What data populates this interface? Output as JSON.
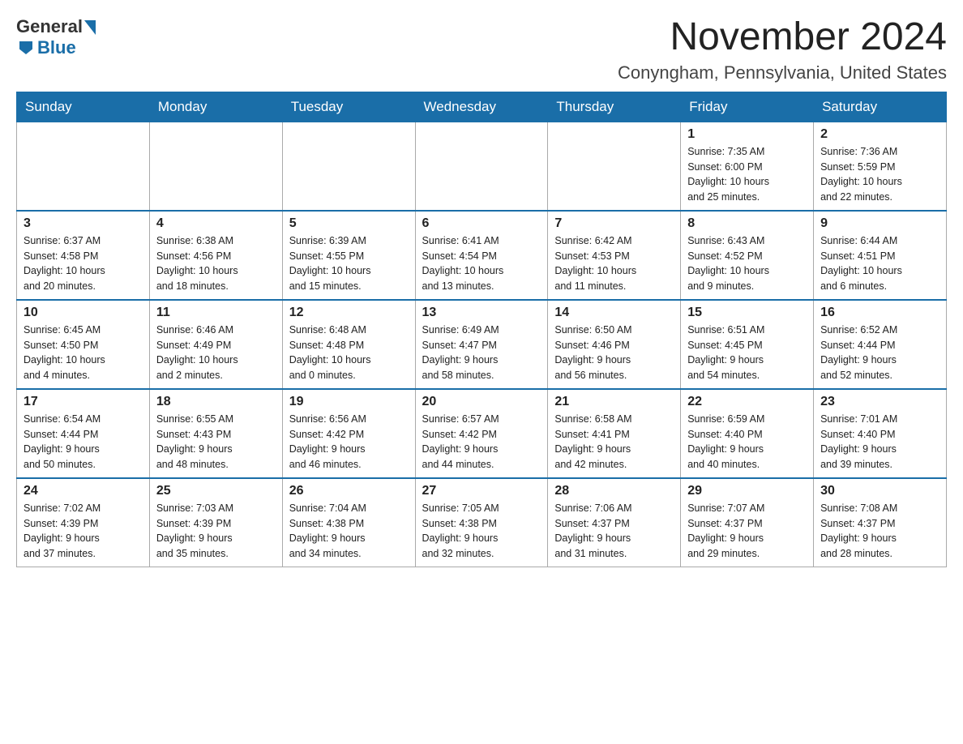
{
  "logo": {
    "general": "General",
    "blue": "Blue"
  },
  "title": "November 2024",
  "location": "Conyngham, Pennsylvania, United States",
  "weekdays": [
    "Sunday",
    "Monday",
    "Tuesday",
    "Wednesday",
    "Thursday",
    "Friday",
    "Saturday"
  ],
  "weeks": [
    [
      {
        "day": "",
        "info": ""
      },
      {
        "day": "",
        "info": ""
      },
      {
        "day": "",
        "info": ""
      },
      {
        "day": "",
        "info": ""
      },
      {
        "day": "",
        "info": ""
      },
      {
        "day": "1",
        "info": "Sunrise: 7:35 AM\nSunset: 6:00 PM\nDaylight: 10 hours\nand 25 minutes."
      },
      {
        "day": "2",
        "info": "Sunrise: 7:36 AM\nSunset: 5:59 PM\nDaylight: 10 hours\nand 22 minutes."
      }
    ],
    [
      {
        "day": "3",
        "info": "Sunrise: 6:37 AM\nSunset: 4:58 PM\nDaylight: 10 hours\nand 20 minutes."
      },
      {
        "day": "4",
        "info": "Sunrise: 6:38 AM\nSunset: 4:56 PM\nDaylight: 10 hours\nand 18 minutes."
      },
      {
        "day": "5",
        "info": "Sunrise: 6:39 AM\nSunset: 4:55 PM\nDaylight: 10 hours\nand 15 minutes."
      },
      {
        "day": "6",
        "info": "Sunrise: 6:41 AM\nSunset: 4:54 PM\nDaylight: 10 hours\nand 13 minutes."
      },
      {
        "day": "7",
        "info": "Sunrise: 6:42 AM\nSunset: 4:53 PM\nDaylight: 10 hours\nand 11 minutes."
      },
      {
        "day": "8",
        "info": "Sunrise: 6:43 AM\nSunset: 4:52 PM\nDaylight: 10 hours\nand 9 minutes."
      },
      {
        "day": "9",
        "info": "Sunrise: 6:44 AM\nSunset: 4:51 PM\nDaylight: 10 hours\nand 6 minutes."
      }
    ],
    [
      {
        "day": "10",
        "info": "Sunrise: 6:45 AM\nSunset: 4:50 PM\nDaylight: 10 hours\nand 4 minutes."
      },
      {
        "day": "11",
        "info": "Sunrise: 6:46 AM\nSunset: 4:49 PM\nDaylight: 10 hours\nand 2 minutes."
      },
      {
        "day": "12",
        "info": "Sunrise: 6:48 AM\nSunset: 4:48 PM\nDaylight: 10 hours\nand 0 minutes."
      },
      {
        "day": "13",
        "info": "Sunrise: 6:49 AM\nSunset: 4:47 PM\nDaylight: 9 hours\nand 58 minutes."
      },
      {
        "day": "14",
        "info": "Sunrise: 6:50 AM\nSunset: 4:46 PM\nDaylight: 9 hours\nand 56 minutes."
      },
      {
        "day": "15",
        "info": "Sunrise: 6:51 AM\nSunset: 4:45 PM\nDaylight: 9 hours\nand 54 minutes."
      },
      {
        "day": "16",
        "info": "Sunrise: 6:52 AM\nSunset: 4:44 PM\nDaylight: 9 hours\nand 52 minutes."
      }
    ],
    [
      {
        "day": "17",
        "info": "Sunrise: 6:54 AM\nSunset: 4:44 PM\nDaylight: 9 hours\nand 50 minutes."
      },
      {
        "day": "18",
        "info": "Sunrise: 6:55 AM\nSunset: 4:43 PM\nDaylight: 9 hours\nand 48 minutes."
      },
      {
        "day": "19",
        "info": "Sunrise: 6:56 AM\nSunset: 4:42 PM\nDaylight: 9 hours\nand 46 minutes."
      },
      {
        "day": "20",
        "info": "Sunrise: 6:57 AM\nSunset: 4:42 PM\nDaylight: 9 hours\nand 44 minutes."
      },
      {
        "day": "21",
        "info": "Sunrise: 6:58 AM\nSunset: 4:41 PM\nDaylight: 9 hours\nand 42 minutes."
      },
      {
        "day": "22",
        "info": "Sunrise: 6:59 AM\nSunset: 4:40 PM\nDaylight: 9 hours\nand 40 minutes."
      },
      {
        "day": "23",
        "info": "Sunrise: 7:01 AM\nSunset: 4:40 PM\nDaylight: 9 hours\nand 39 minutes."
      }
    ],
    [
      {
        "day": "24",
        "info": "Sunrise: 7:02 AM\nSunset: 4:39 PM\nDaylight: 9 hours\nand 37 minutes."
      },
      {
        "day": "25",
        "info": "Sunrise: 7:03 AM\nSunset: 4:39 PM\nDaylight: 9 hours\nand 35 minutes."
      },
      {
        "day": "26",
        "info": "Sunrise: 7:04 AM\nSunset: 4:38 PM\nDaylight: 9 hours\nand 34 minutes."
      },
      {
        "day": "27",
        "info": "Sunrise: 7:05 AM\nSunset: 4:38 PM\nDaylight: 9 hours\nand 32 minutes."
      },
      {
        "day": "28",
        "info": "Sunrise: 7:06 AM\nSunset: 4:37 PM\nDaylight: 9 hours\nand 31 minutes."
      },
      {
        "day": "29",
        "info": "Sunrise: 7:07 AM\nSunset: 4:37 PM\nDaylight: 9 hours\nand 29 minutes."
      },
      {
        "day": "30",
        "info": "Sunrise: 7:08 AM\nSunset: 4:37 PM\nDaylight: 9 hours\nand 28 minutes."
      }
    ]
  ]
}
